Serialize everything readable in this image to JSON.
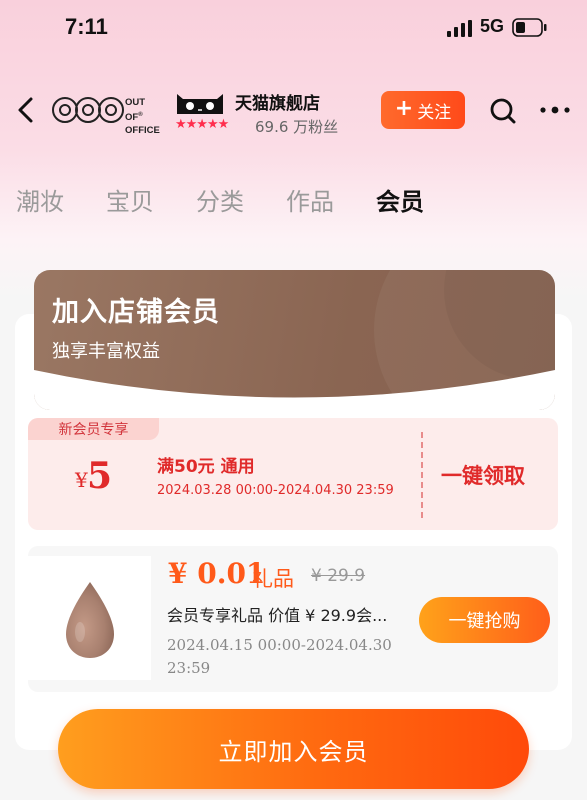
{
  "status_bar": {
    "time": "7:11",
    "network": "5G"
  },
  "header": {
    "brand_line1": "OUT OF",
    "brand_mark": "®",
    "brand_line2": "OFFICE",
    "store_name": "天猫旗舰店",
    "stars": "★★★★★",
    "fans": "69.6 万粉丝",
    "follow_label": "关注"
  },
  "tabs": [
    "潮妆",
    "宝贝",
    "分类",
    "作品",
    "会员"
  ],
  "active_tab": 4,
  "banner": {
    "title": "加入店铺会员",
    "subtitle": "独享丰富权益"
  },
  "coupon": {
    "tag": "新会员专享",
    "currency": "¥",
    "amount": "5",
    "condition": "满50元 通用",
    "date": "2024.03.28 00:00-2024.04.30 23:59",
    "claim_label": "一键领取"
  },
  "gift": {
    "price": "¥ 0.01",
    "kind": "礼品",
    "original_price": "¥ 29.9",
    "title": "会员专享礼品 价值 ¥ 29.9会...",
    "date_line1": "2024.04.15 00:00-2024.04.30",
    "date_line2": "23:59",
    "grab_label": "一键抢购"
  },
  "cta": {
    "join_label": "立即加入会员"
  },
  "colors": {
    "accent": "#ff5a1a",
    "coupon_red": "#e02a2a",
    "banner_brown": "#8a6552"
  }
}
